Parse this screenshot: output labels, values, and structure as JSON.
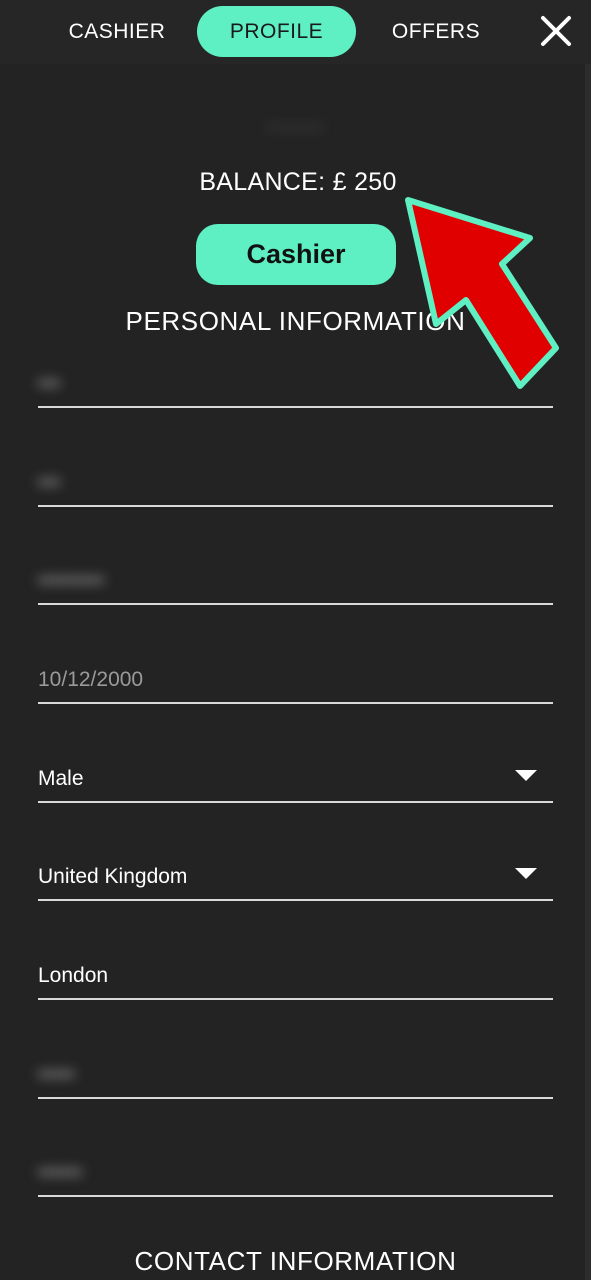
{
  "nav": {
    "tabs": [
      {
        "label": "CASHIER"
      },
      {
        "label": "PROFILE"
      },
      {
        "label": "OFFERS"
      }
    ],
    "close_icon": "close-icon"
  },
  "account": {
    "username": "·········",
    "balance": "BALANCE: £ 250",
    "cashier_button": "Cashier"
  },
  "personal": {
    "heading": "PERSONAL INFORMATION",
    "fields": [
      {
        "value": "•••",
        "blurred": true
      },
      {
        "value": "•••",
        "blurred": true
      },
      {
        "value": "•••••••••",
        "blurred": true
      },
      {
        "value": "10/12/2000",
        "muted": true
      },
      {
        "value": "Male",
        "dropdown": true
      },
      {
        "value": "United Kingdom",
        "dropdown": true
      },
      {
        "value": "London"
      },
      {
        "value": "•••••",
        "blurred": true
      },
      {
        "value": "••••••",
        "blurred": true
      }
    ]
  },
  "contact": {
    "heading": "CONTACT INFORMATION"
  },
  "colors": {
    "accent": "#5ef0c2",
    "background": "#232323",
    "arrow_fill": "#e00000"
  }
}
